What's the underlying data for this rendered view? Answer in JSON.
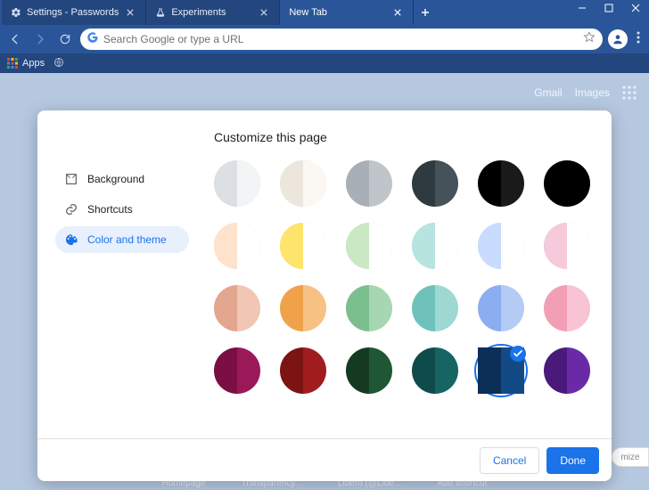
{
  "tabs": [
    {
      "title": "Settings - Passwords",
      "icon": "gear"
    },
    {
      "title": "Experiments",
      "icon": "flask"
    },
    {
      "title": "New Tab",
      "icon": "",
      "active": true
    }
  ],
  "omnibox": {
    "placeholder": "Search Google or type a URL"
  },
  "bookmarks_bar": {
    "apps_label": "Apps"
  },
  "ntp": {
    "links": {
      "gmail": "Gmail",
      "images": "Images"
    },
    "shortcuts": [
      "Homepage",
      "Transparency...",
      "Libero (@Libe...",
      "Add shortcut"
    ]
  },
  "dialog": {
    "title": "Customize this page",
    "sidebar": [
      {
        "id": "background",
        "label": "Background"
      },
      {
        "id": "shortcuts",
        "label": "Shortcuts"
      },
      {
        "id": "color-theme",
        "label": "Color and theme",
        "selected": true
      }
    ],
    "swatches": [
      {
        "l": "#dcdfe3",
        "r": "#f3f4f5",
        "thin": true
      },
      {
        "l": "#ede6dd",
        "r": "#fbf7f2",
        "thin": true
      },
      {
        "l": "#a9afb6",
        "r": "#c0c5cb"
      },
      {
        "l": "#2e3a40",
        "r": "#44525a"
      },
      {
        "l": "#000000",
        "r": "#1a1a1a"
      },
      {
        "l": "#000000",
        "r": "#000000"
      },
      {
        "l": "#ffe2cc",
        "r": "#ffffff",
        "thin": true
      },
      {
        "l": "#ffe46b",
        "r": "#ffffff",
        "thin": true
      },
      {
        "l": "#cbe8c4",
        "r": "#ffffff",
        "thin": true
      },
      {
        "l": "#b8e4e0",
        "r": "#ffffff",
        "thin": true
      },
      {
        "l": "#c9dcff",
        "r": "#ffffff",
        "thin": true
      },
      {
        "l": "#f6cada",
        "r": "#ffffff",
        "thin": true
      },
      {
        "l": "#e3a68f",
        "r": "#f1c6b4"
      },
      {
        "l": "#f0a24a",
        "r": "#f7c184"
      },
      {
        "l": "#7cbf8e",
        "r": "#a6d7b2"
      },
      {
        "l": "#6fc2bb",
        "r": "#9fd8d2"
      },
      {
        "l": "#8aaef0",
        "r": "#b4cbf6"
      },
      {
        "l": "#f29fb6",
        "r": "#f8c3d2"
      },
      {
        "l": "#7a0f45",
        "r": "#9b1859"
      },
      {
        "l": "#7d1414",
        "r": "#a11d1d"
      },
      {
        "l": "#143b22",
        "r": "#1f5633"
      },
      {
        "l": "#0f4b4b",
        "r": "#176464"
      },
      {
        "l": "#0b2f57",
        "r": "#134a86",
        "selected": true
      },
      {
        "l": "#4a1a7a",
        "r": "#6a2aa8"
      }
    ],
    "footer": {
      "cancel": "Cancel",
      "done": "Done"
    }
  },
  "customize_peek": "mize"
}
